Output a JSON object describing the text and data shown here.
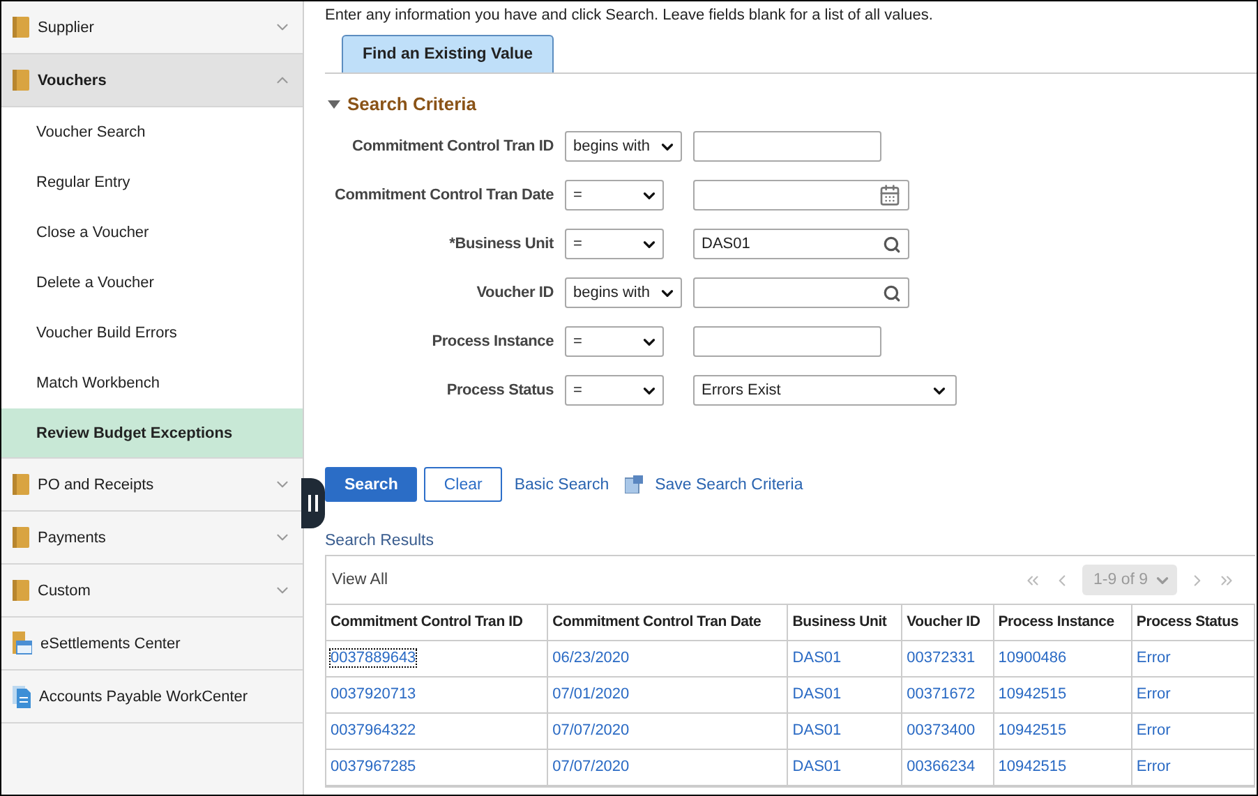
{
  "sidebar": {
    "items": [
      {
        "label": "Supplier",
        "kind": "folder",
        "expanded": false
      },
      {
        "label": "Vouchers",
        "kind": "folder",
        "expanded": true,
        "children": [
          {
            "label": "Voucher Search",
            "selected": false
          },
          {
            "label": "Regular Entry",
            "selected": false
          },
          {
            "label": "Close a Voucher",
            "selected": false
          },
          {
            "label": "Delete a Voucher",
            "selected": false
          },
          {
            "label": "Voucher Build Errors",
            "selected": false
          },
          {
            "label": "Match Workbench",
            "selected": false
          },
          {
            "label": "Review Budget Exceptions",
            "selected": true
          }
        ]
      },
      {
        "label": "PO and Receipts",
        "kind": "folder",
        "expanded": false
      },
      {
        "label": "Payments",
        "kind": "folder",
        "expanded": false
      },
      {
        "label": "Custom",
        "kind": "folder",
        "expanded": false
      },
      {
        "label": "eSettlements Center",
        "kind": "center"
      },
      {
        "label": "Accounts Payable WorkCenter",
        "kind": "workcenter"
      }
    ]
  },
  "instructions": "Enter any information you have and click Search. Leave fields blank for a list of all values.",
  "tabs": [
    {
      "label": "Find an Existing Value",
      "selected": true
    }
  ],
  "search_criteria": {
    "title": "Search Criteria",
    "expanded": true,
    "fields": [
      {
        "label": "Commitment Control Tran ID",
        "operator": "begins with",
        "kind": "text"
      },
      {
        "label": "Commitment Control Tran Date",
        "operator": "=",
        "kind": "date"
      },
      {
        "label": "*Business Unit",
        "operator": "=",
        "kind": "lookup",
        "value": "DAS01"
      },
      {
        "label": "Voucher ID",
        "operator": "begins with",
        "kind": "lookup"
      },
      {
        "label": "Process Instance",
        "operator": "=",
        "kind": "text"
      },
      {
        "label": "Process Status",
        "operator": "=",
        "kind": "select",
        "value": "Errors Exist"
      }
    ]
  },
  "buttons": {
    "search": "Search",
    "clear": "Clear",
    "basic_search": "Basic Search",
    "save_criteria": "Save Search Criteria"
  },
  "results": {
    "title": "Search Results",
    "view_all": "View All",
    "pagination": "1-9 of 9",
    "columns": [
      "Commitment Control Tran ID",
      "Commitment Control Tran Date",
      "Business Unit",
      "Voucher ID",
      "Process Instance",
      "Process Status"
    ],
    "rows": [
      {
        "focused": true,
        "cells": [
          "0037889643",
          "06/23/2020",
          "DAS01",
          "00372331",
          "10900486",
          "Error"
        ]
      },
      {
        "focused": false,
        "cells": [
          "0037920713",
          "07/01/2020",
          "DAS01",
          "00371672",
          "10942515",
          "Error"
        ]
      },
      {
        "focused": false,
        "cells": [
          "0037964322",
          "07/07/2020",
          "DAS01",
          "00373400",
          "10942515",
          "Error"
        ]
      },
      {
        "focused": false,
        "cells": [
          "0037967285",
          "07/07/2020",
          "DAS01",
          "00366234",
          "10942515",
          "Error"
        ]
      }
    ]
  }
}
